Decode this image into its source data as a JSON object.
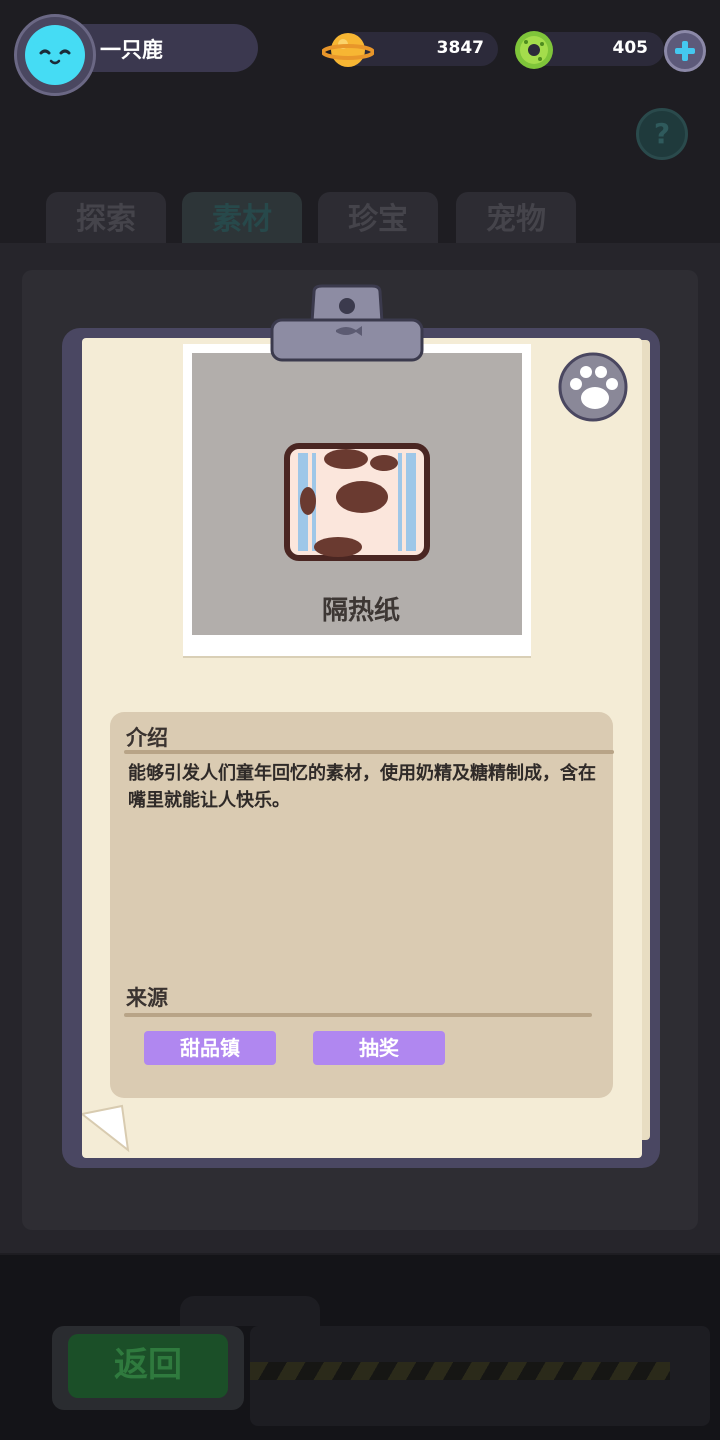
{
  "player": {
    "name": "一只鹿"
  },
  "currencies": {
    "coins": "3847",
    "gems": "405"
  },
  "tabs": [
    {
      "label": "探索"
    },
    {
      "label": "素材"
    },
    {
      "label": "珍宝"
    },
    {
      "label": "宠物"
    }
  ],
  "item": {
    "name": "隔热纸",
    "intro_title": "介绍",
    "intro_text": "能够引发人们童年回忆的素材，使用奶精及糖精制成，含在嘴里就能让人快乐。",
    "source_title": "来源",
    "sources": [
      {
        "label": "甜品镇"
      },
      {
        "label": "抽奖"
      }
    ]
  },
  "footer": {
    "back_label": "返回"
  },
  "icons": {
    "avatar": "cat-avatar-icon",
    "coin": "planet-coin-icon",
    "gem": "donut-gem-icon",
    "add": "plus-icon",
    "help": "question-icon",
    "paw": "paw-icon"
  },
  "colors": {
    "accent_purple": "#b087f0",
    "paper": "#f4ecd6",
    "board": "#4a4762",
    "cyan": "#44c8f0"
  }
}
